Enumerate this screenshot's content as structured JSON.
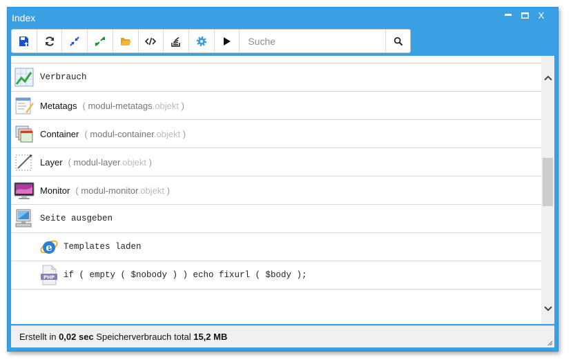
{
  "window": {
    "title": "Index",
    "min": "▬",
    "max": "☐",
    "close": "X"
  },
  "toolbar": {
    "search_placeholder": "Suche"
  },
  "rows": [
    {
      "label": "Verbrauch"
    },
    {
      "label": "Metatags",
      "mod_name": "modul-metatags",
      "mod_ext": ".objekt"
    },
    {
      "label": "Container",
      "mod_name": "modul-container",
      "mod_ext": ".objekt"
    },
    {
      "label": "Layer",
      "mod_name": "modul-layer",
      "mod_ext": ".objekt"
    },
    {
      "label": "Monitor",
      "mod_name": "modul-monitor",
      "mod_ext": ".objekt"
    },
    {
      "label": "Seite ausgeben"
    },
    {
      "label": "Templates laden"
    },
    {
      "label": "if ( empty ( $nobody ) ) echo fixurl ( $body );",
      "badge": "PHP"
    }
  ],
  "status": {
    "prefix": "Erstellt in ",
    "time": "0,02 sec",
    "middle": " Speicherverbrauch total ",
    "memory": "15,2 MB"
  },
  "colors": {
    "titlebar": "#3aa0e4",
    "accent": "#1c4fd1"
  }
}
